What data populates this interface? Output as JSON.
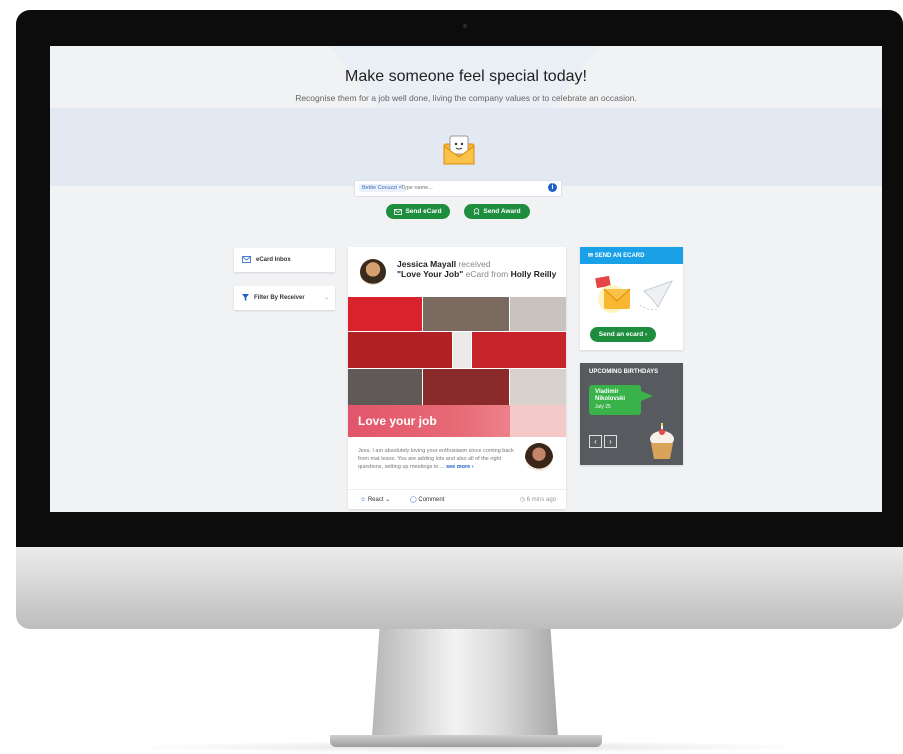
{
  "hero": {
    "headline": "Make someone feel special today!",
    "subline": "Recognise them for a job well done, living the company values or to celebrate an occasion."
  },
  "recipient_search": {
    "chip_label": "Bettie Cocuzzi ×",
    "placeholder": "Type name..."
  },
  "actions": {
    "send_ecard": "Send eCard",
    "send_award": "Send Award"
  },
  "sidebar": {
    "inbox_label": "eCard Inbox",
    "filter_label": "Filter By Receiver"
  },
  "post": {
    "sender": "Jessica Mayall",
    "verb": " received ",
    "ecard_name": "\"Love Your Job\"",
    "ecard_suffix": " eCard from ",
    "from": "Holly Reilly",
    "banner_text": "Love your job",
    "excerpt": "Jess, I am absolutely loving your enthusiasm since coming back from mat leave. You are adding lots and also all of the right questions, setting up meetings to ...",
    "see_more": "see more ›",
    "react_label": "React ⌄",
    "comment_label": "Comment",
    "time": "6 mins ago"
  },
  "send_ecard_widget": {
    "title": "✉ SEND AN ECARD",
    "button_label": "Send an ecard ›"
  },
  "birthdays": {
    "title": "UPCOMING BIRTHDAYS",
    "name": "Vladimir Nikolovski",
    "date": "July 25"
  },
  "colors": {
    "primary_green": "#1e8e3e",
    "accent_blue": "#1aa0e6",
    "link_blue": "#1f62c7",
    "love_red": "#e2556b"
  }
}
